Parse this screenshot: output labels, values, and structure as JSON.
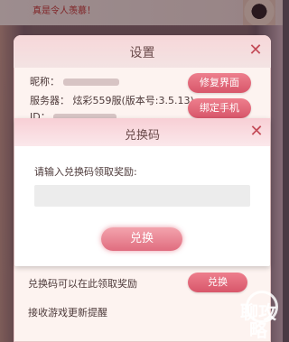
{
  "banner": {
    "text": "真是令人羡慕！"
  },
  "settings": {
    "title": "设置",
    "close_label": "✕",
    "nickname_label": "昵称：",
    "server_label": "服务器：",
    "server_value": "炫彩559服(版本号:3.5.13)",
    "id_label": "ID：",
    "repair_button": "修复界面",
    "bind_phone_button": "绑定手机",
    "redeem_hint": "兑换码可以在此领取奖励",
    "redeem_button": "兑换",
    "notify_label": "接收游戏更新提醒"
  },
  "redeem_dialog": {
    "title": "兑换码",
    "close_label": "✕",
    "prompt": "请输入兑换码领取奖励:",
    "input_value": "",
    "input_placeholder": "",
    "confirm_button": "兑换"
  },
  "watermark": {
    "text": "聊攻略"
  }
}
